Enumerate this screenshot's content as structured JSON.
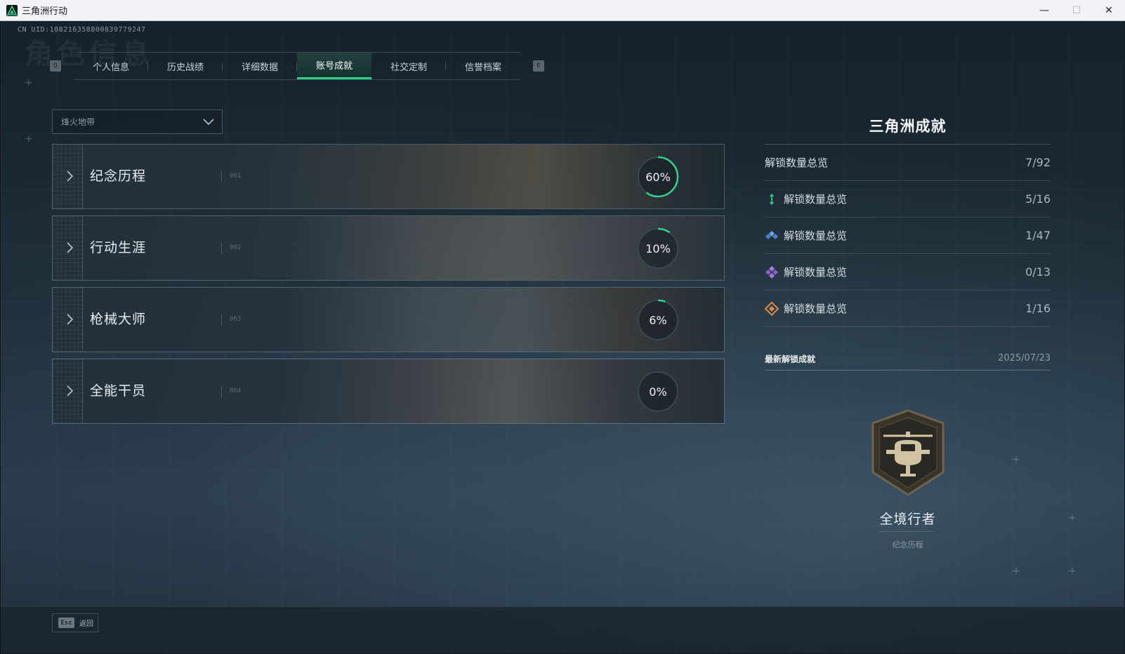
{
  "window": {
    "title": "三角洲行动",
    "controls": {
      "minimize": "—",
      "maximize": "☐",
      "close": "✕"
    }
  },
  "header": {
    "uid": "CN UID:18821635880083977924​7",
    "background_heading": "角色信息"
  },
  "tabs": {
    "prev_key": "Q",
    "next_key": "E",
    "items": [
      {
        "label": "个人信息",
        "active": false
      },
      {
        "label": "历史战绩",
        "active": false
      },
      {
        "label": "详细数据",
        "active": false
      },
      {
        "label": "账号成就",
        "active": true
      },
      {
        "label": "社交定制",
        "active": false
      },
      {
        "label": "信誉档案",
        "active": false
      }
    ]
  },
  "mode_select": {
    "value": "烽火地带"
  },
  "categories": [
    {
      "title": "纪念历程",
      "index": "001",
      "progress_percent": 60,
      "progress_label": "60%"
    },
    {
      "title": "行动生涯",
      "index": "002",
      "progress_percent": 10,
      "progress_label": "10%"
    },
    {
      "title": "枪械大师",
      "index": "003",
      "progress_percent": 6,
      "progress_label": "6%"
    },
    {
      "title": "全能干员",
      "index": "004",
      "progress_percent": 0,
      "progress_label": "0%"
    }
  ],
  "summary": {
    "title": "三角洲成就",
    "total": {
      "label": "解锁数量总览",
      "value": "7/92"
    },
    "tiers": [
      {
        "label": "解锁数量总览",
        "value": "5/16",
        "icon": "green-tier-icon",
        "color": "#2ec27e"
      },
      {
        "label": "解锁数量总览",
        "value": "1/47",
        "icon": "blue-tier-icon",
        "color": "#5b8fd6"
      },
      {
        "label": "解锁数量总览",
        "value": "0/13",
        "icon": "purple-tier-icon",
        "color": "#9b6fd6"
      },
      {
        "label": "解锁数量总览",
        "value": "1/16",
        "icon": "orange-tier-icon",
        "color": "#e08a4a"
      }
    ]
  },
  "latest": {
    "label": "最新解锁成就",
    "date": "2025/07/23",
    "badge_name": "全境行者",
    "badge_category": "纪念历程",
    "badge_icon": "helicopter-badge-icon"
  },
  "footer": {
    "esc_key": "Esc",
    "back_label": "返回"
  },
  "colors": {
    "accent": "#2ed38f",
    "ring_track": "#3a4650"
  }
}
